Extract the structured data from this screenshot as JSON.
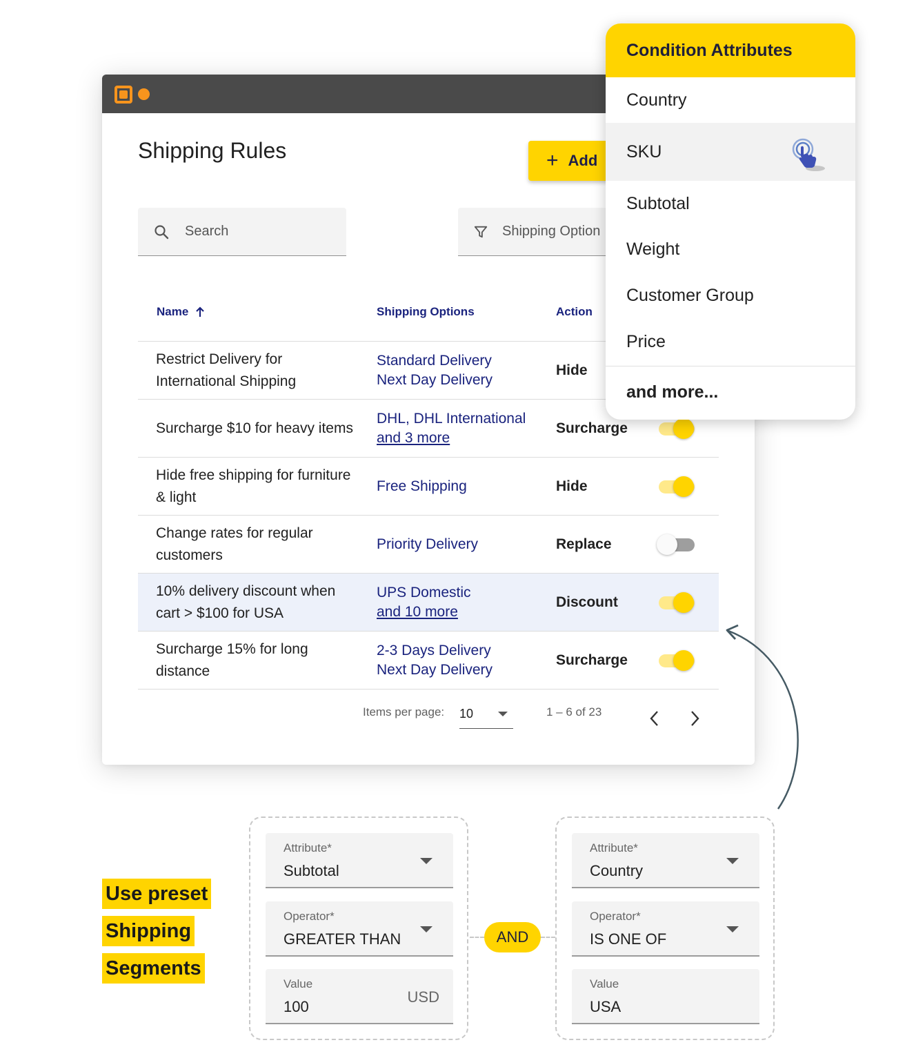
{
  "page": {
    "title": "Shipping Rules",
    "add_label": "Add",
    "search_placeholder": "Search",
    "filter_label": "Shipping Option"
  },
  "table": {
    "headers": {
      "name": "Name",
      "shipping_options": "Shipping Options",
      "action": "Action"
    },
    "rows": [
      {
        "name": "Restrict Delivery for International Shipping",
        "options": [
          "Standard Delivery",
          "Next Day Delivery"
        ],
        "action": "Hide",
        "enabled": true
      },
      {
        "name": "Surcharge $10 for heavy items",
        "options": [
          "DHL, DHL International",
          "and 3 more"
        ],
        "action": "Surcharge",
        "enabled": true
      },
      {
        "name": "Hide free shipping for furniture & light",
        "options": [
          "Free Shipping"
        ],
        "action": "Hide",
        "enabled": true
      },
      {
        "name": "Change rates for regular customers",
        "options": [
          "Priority Delivery"
        ],
        "action": "Replace",
        "enabled": false
      },
      {
        "name": "10% delivery discount when cart > $100 for USA",
        "options": [
          "UPS Domestic",
          "and 10 more"
        ],
        "action": "Discount",
        "enabled": true
      },
      {
        "name": "Surcharge 15% for long distance",
        "options": [
          "2-3 Days Delivery",
          "Next Day Delivery"
        ],
        "action": "Surcharge",
        "enabled": true
      }
    ]
  },
  "pagination": {
    "items_per_page_label": "Items per page:",
    "page_size": "10",
    "range": "1 – 6 of 23"
  },
  "dropdown": {
    "header": "Condition Attributes",
    "items": [
      "Country",
      "SKU",
      "Subtotal",
      "Weight",
      "Customer Group",
      "Price"
    ],
    "more": "and more...",
    "active_item": "SKU"
  },
  "segments": {
    "left": {
      "attribute_label": "Attribute*",
      "attribute_value": "Subtotal",
      "operator_label": "Operator*",
      "operator_value": "GREATER THAN",
      "value_label": "Value",
      "value": "100",
      "unit": "USD"
    },
    "joiner": "AND",
    "right": {
      "attribute_label": "Attribute*",
      "attribute_value": "Country",
      "operator_label": "Operator*",
      "operator_value": "IS ONE OF",
      "value_label": "Value",
      "value": "USA"
    }
  },
  "promo": [
    "Use preset",
    "Shipping",
    "Segments"
  ],
  "colors": {
    "accent": "#ffd400",
    "link": "#1a237e",
    "titlebar": "#4a4a4a",
    "logo": "#f7941d",
    "row_highlight": "#edf1fa"
  },
  "icons": [
    "search-icon",
    "filter-icon",
    "plus-icon",
    "arrow-up-icon",
    "chevron-left-icon",
    "chevron-right-icon",
    "dropdown-caret-icon",
    "pointer-hand-icon"
  ]
}
